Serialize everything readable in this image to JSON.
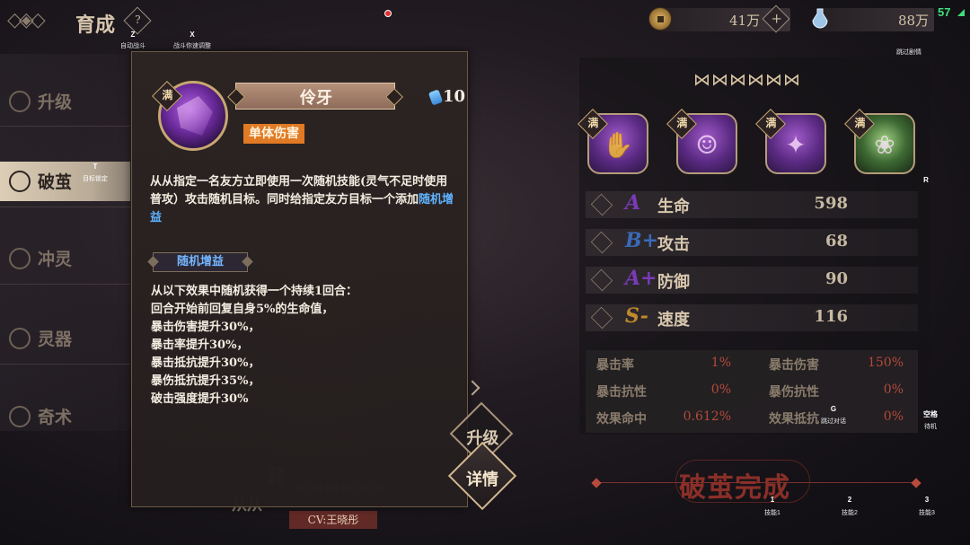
{
  "header": {
    "title": "育成",
    "help_label": "?"
  },
  "hotkeys": {
    "auto_battle_key": "Z",
    "auto_battle_label": "自动战斗",
    "speed_key": "X",
    "speed_label": "战斗你速调整",
    "skip_label": "跳过剧情",
    "target_key": "T",
    "target_label": "目标锁定",
    "r_key": "R",
    "g_key": "G",
    "g_label": "跳过对话",
    "space_key": "空格",
    "space_label": "待机",
    "skill1_key": "1",
    "skill1_label": "技能1",
    "skill2_key": "2",
    "skill2_label": "技能2",
    "skill3_key": "3",
    "skill3_label": "技能3"
  },
  "currency": {
    "coins": "41万",
    "plus": "+",
    "gems": "88万"
  },
  "fps": "57",
  "nav": {
    "items": [
      {
        "label": "升级"
      },
      {
        "label": "破茧"
      },
      {
        "label": "冲灵"
      },
      {
        "label": "灵器"
      },
      {
        "label": "奇术"
      }
    ],
    "active_index": 1
  },
  "skill_popup": {
    "full_badge": "满",
    "name": "伶牙",
    "cost": "10",
    "tag": "单体伤害",
    "desc_part1": "从从指定一名友方立即使用一次随机技能(灵气不足时使用普攻）攻击随机目标。同时给指定友方目标一个添加",
    "desc_highlight": "随机增益",
    "sub_header": "随机增益",
    "effects": [
      "从以下效果中随机获得一个持续1回合：",
      "回合开始前回复自身5%的生命值，",
      "暴击伤害提升30%，",
      "暴击率提升30%，",
      "暴击抵抗提升30%，",
      "暴伤抵抗提升35%，",
      "破击强度提升30%"
    ]
  },
  "character": {
    "name": "从从",
    "cv": "CV:王晓彤",
    "rank": "R",
    "stars": "𝅘 𝅘 𝅘 𝅘 𝅘 𝅘"
  },
  "buttons": {
    "upgrade": "升级",
    "details": "详情"
  },
  "right_panel": {
    "butterflies": "⋈⋈⋈⋈⋈⋈",
    "skill_slots": [
      {
        "badge": "满",
        "glyph": "✋"
      },
      {
        "badge": "满",
        "glyph": "☺"
      },
      {
        "badge": "满",
        "glyph": "✦"
      },
      {
        "badge": "满",
        "glyph": "❀"
      }
    ],
    "stats": [
      {
        "grade": "A",
        "label": "生命",
        "value": "598",
        "color": "#7a3ab8"
      },
      {
        "grade": "B+",
        "label": "攻击",
        "value": "68",
        "color": "#3a6ab8"
      },
      {
        "grade": "A+",
        "label": "防御",
        "value": "90",
        "color": "#7a3ab8"
      },
      {
        "grade": "S-",
        "label": "速度",
        "value": "116",
        "color": "#c08a2a"
      }
    ],
    "sub_stats": [
      {
        "label": "暴击率",
        "value": "1%"
      },
      {
        "label": "暴击伤害",
        "value": "150%"
      },
      {
        "label": "暴击抗性",
        "value": "0%"
      },
      {
        "label": "暴伤抗性",
        "value": "0%"
      },
      {
        "label": "效果命中",
        "value": "0.612%"
      },
      {
        "label": "效果抵抗",
        "value": "0%"
      }
    ]
  },
  "complete_banner": "破茧完成"
}
